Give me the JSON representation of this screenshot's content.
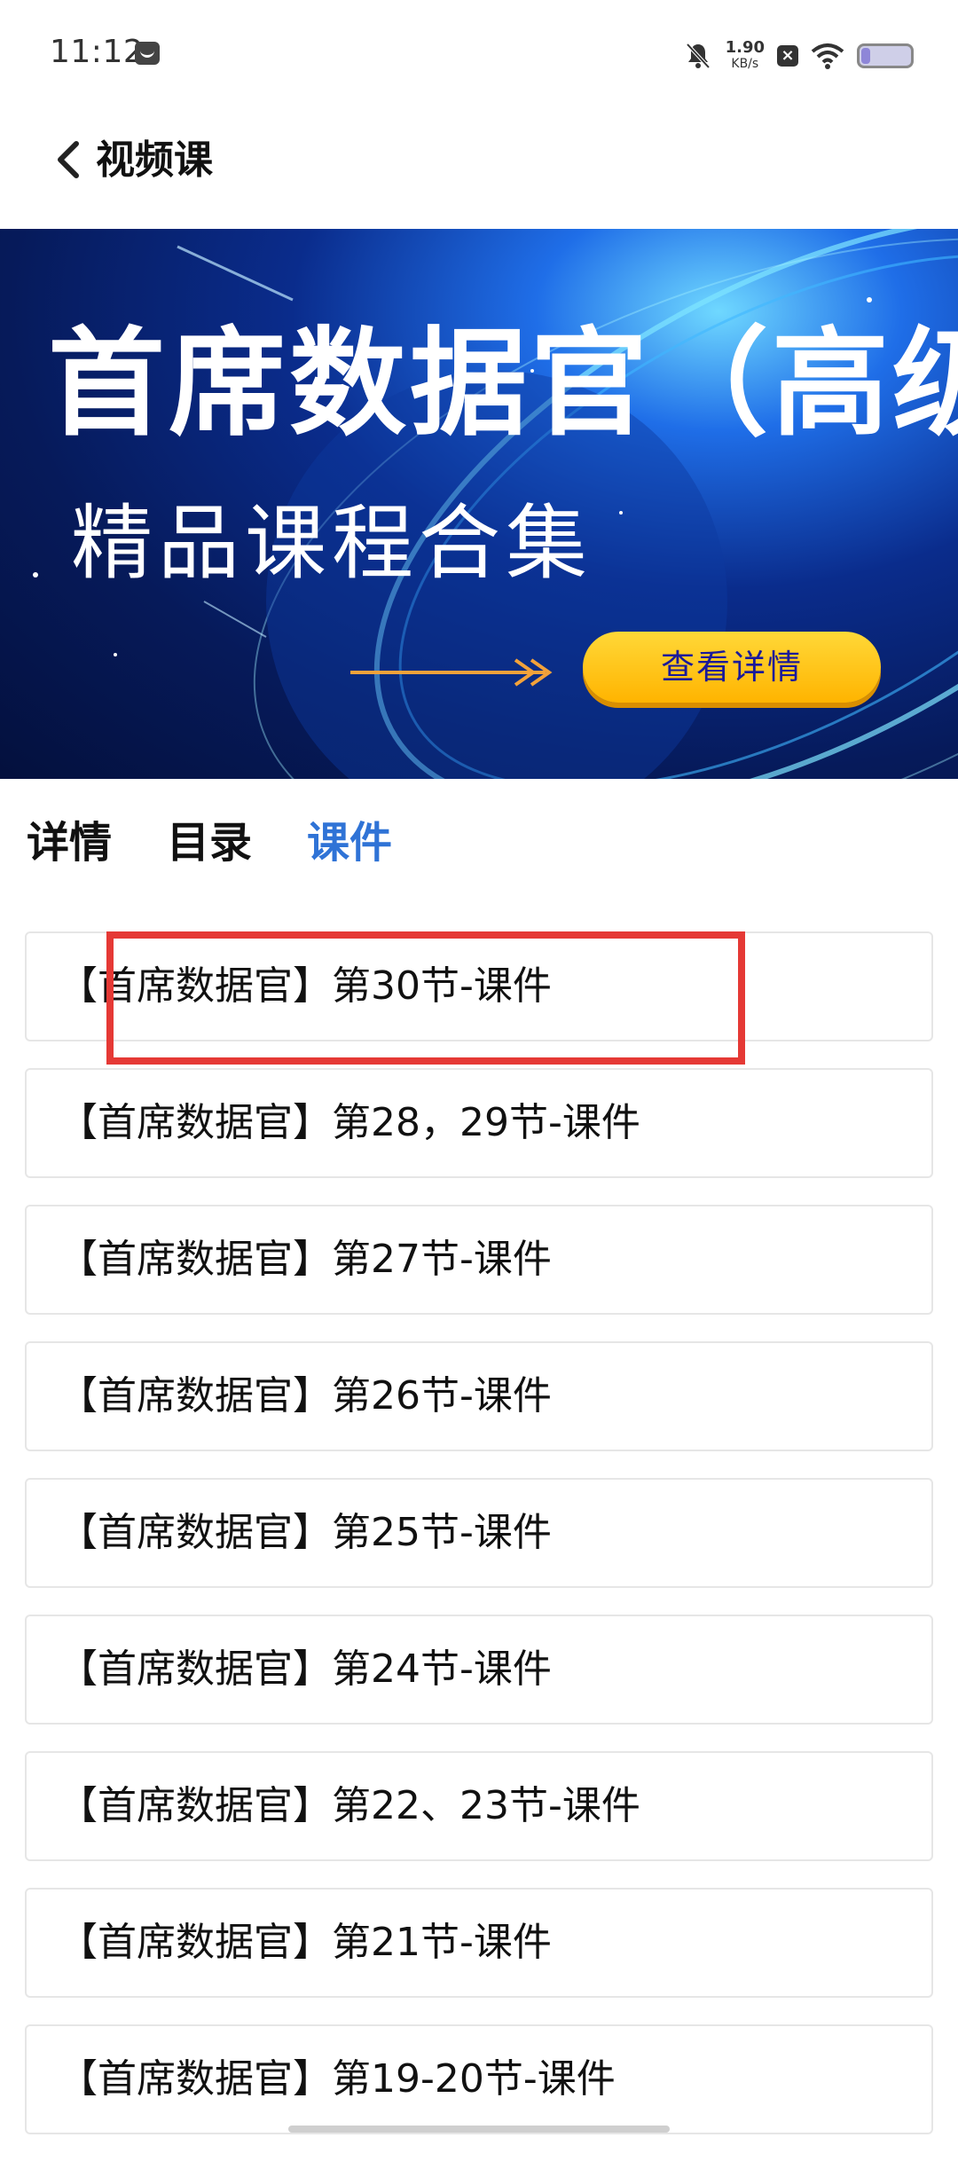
{
  "status_bar": {
    "time": "11:12",
    "speed_value": "1.90",
    "speed_unit": "KB/s",
    "battery_level": 0.18
  },
  "header": {
    "title": "视频课"
  },
  "banner": {
    "title": "首席数据官（高级）",
    "subtitle": "精品课程合集",
    "button_label": "查看详情"
  },
  "tabs": [
    {
      "label": "详情",
      "active": false
    },
    {
      "label": "目录",
      "active": false
    },
    {
      "label": "课件",
      "active": true
    }
  ],
  "courseware": [
    "【首席数据官】第30节-课件",
    "【首席数据官】第28，29节-课件",
    "【首席数据官】第27节-课件",
    "【首席数据官】第26节-课件",
    "【首席数据官】第25节-课件",
    "【首席数据官】第24节-课件",
    "【首席数据官】第22、23节-课件",
    "【首席数据官】第21节-课件",
    "【首席数据官】第19-20节-课件"
  ],
  "colors": {
    "active_tab": "#2f73d6",
    "highlight": "#e53935",
    "button_bg": "#ffc21a",
    "button_text": "#1a1a9a"
  }
}
